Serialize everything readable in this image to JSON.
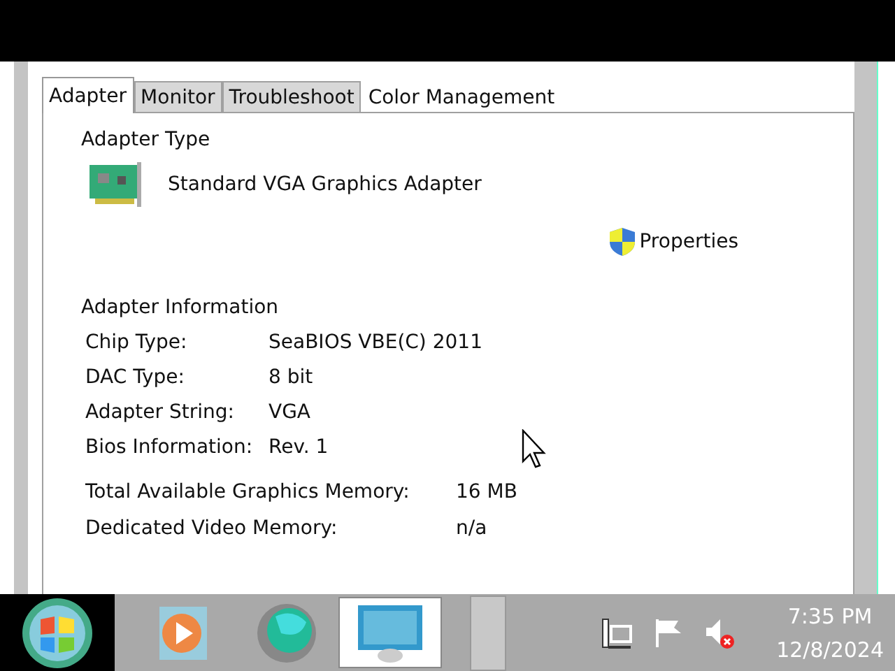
{
  "tabs": [
    {
      "label": "Adapter",
      "selected": true
    },
    {
      "label": "Monitor",
      "selected": false
    },
    {
      "label": "Troubleshoot",
      "selected": false
    },
    {
      "label": "Color Management",
      "selected": false
    }
  ],
  "adapter_type": {
    "heading": "Adapter Type",
    "name": "Standard VGA Graphics Adapter",
    "properties_button": "Properties"
  },
  "adapter_information": {
    "heading": "Adapter Information",
    "rows": [
      {
        "label": "Chip Type:",
        "value": "SeaBIOS VBE(C) 2011"
      },
      {
        "label": "DAC Type:",
        "value": "8 bit"
      },
      {
        "label": "Adapter String:",
        "value": "VGA"
      },
      {
        "label": "Bios Information:",
        "value": "Rev. 1"
      }
    ],
    "memory_rows": [
      {
        "label": "Total Available Graphics Memory:",
        "value": "16 MB"
      },
      {
        "label": "Dedicated Video Memory:",
        "value": "n/a"
      }
    ]
  },
  "taskbar": {
    "apps": [
      {
        "kind": "media",
        "selected": false
      },
      {
        "kind": "globe",
        "selected": false
      },
      {
        "kind": "display",
        "selected": true
      }
    ],
    "clock": {
      "time": "7:35 PM",
      "date": "12/8/2024"
    }
  }
}
